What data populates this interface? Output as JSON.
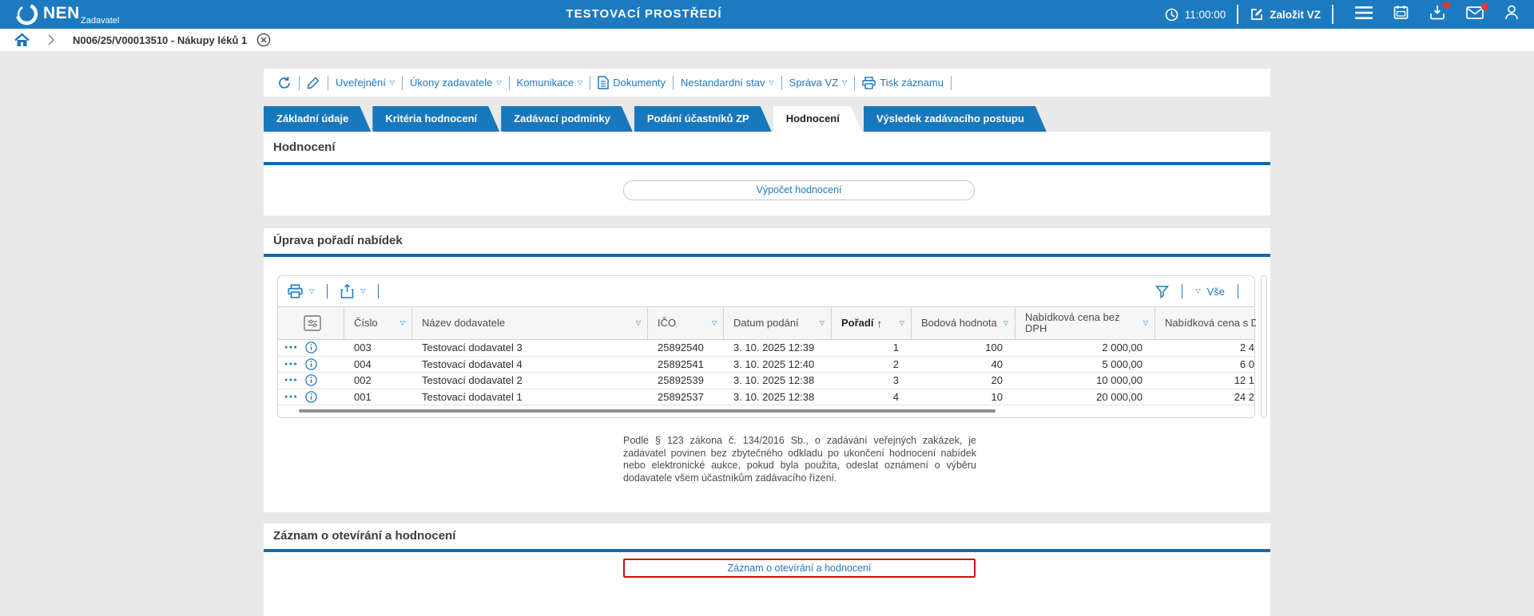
{
  "header": {
    "logo": "NEN",
    "logo_subtitle": "Zadavatel",
    "environment_title": "TESTOVACÍ PROSTŘEDÍ",
    "clock_time": "11:00:00",
    "create_button": "Založit VZ"
  },
  "breadcrumb": {
    "item": "N006/25/V00013510 - Nákupy léků 1"
  },
  "toolbar": {
    "items": [
      "Uveřejnění",
      "Úkony zadavatele",
      "Komunikace",
      "Dokumenty",
      "Nestandardní stav",
      "Správa VZ",
      "Tisk záznamu"
    ]
  },
  "tabs": [
    "Základní údaje",
    "Kritéria hodnocení",
    "Zadávací podmínky",
    "Podání účastníků ZP",
    "Hodnocení",
    "Výsledek zadávacího postupu"
  ],
  "active_tab": "Hodnocení",
  "sections": {
    "hodnoceni": {
      "title": "Hodnocení",
      "compute_button": "Výpočet hodnocení"
    },
    "uprava": {
      "title": "Úprava pořadí nabídek",
      "note": "Podle § 123 zákona č. 134/2016 Sb., o zadávání veřejných zakázek, je zadavatel povinen bez zbytečného odkladu po ukončení hodnocení nabídek nebo elektronické aukce, pokud byla použita, odeslat oznámení o výběru dodavatele všem účastníkům zadávacího řízení."
    },
    "zaznam": {
      "title": "Záznam o otevírání a hodnocení",
      "record_button": "Záznam o otevírání a hodnocení"
    }
  },
  "table": {
    "filter_all_label": "Vše",
    "columns": [
      "Číslo",
      "Název dodavatele",
      "IČO",
      "Datum podání",
      "Pořadí",
      "Bodová hodnota",
      "Nabídková cena bez DPH",
      "Nabídková cena s DPH"
    ],
    "sorted_column": "Pořadí",
    "rows": [
      {
        "cislo": "003",
        "nazev": "Testovací dodavatel 3",
        "ico": "25892540",
        "datum": "3. 10. 2025 12:39",
        "poradi": "1",
        "body": "100",
        "cena_bez_dph": "2 000,00",
        "cena_s_dph": "2 4"
      },
      {
        "cislo": "004",
        "nazev": "Testovací dodavatel 4",
        "ico": "25892541",
        "datum": "3. 10. 2025 12:40",
        "poradi": "2",
        "body": "40",
        "cena_bez_dph": "5 000,00",
        "cena_s_dph": "6 0"
      },
      {
        "cislo": "002",
        "nazev": "Testovací dodavatel 2",
        "ico": "25892539",
        "datum": "3. 10. 2025 12:38",
        "poradi": "3",
        "body": "20",
        "cena_bez_dph": "10 000,00",
        "cena_s_dph": "12 1"
      },
      {
        "cislo": "001",
        "nazev": "Testovací dodavatel 1",
        "ico": "25892537",
        "datum": "3. 10. 2025 12:38",
        "poradi": "4",
        "body": "10",
        "cena_bez_dph": "20 000,00",
        "cena_s_dph": "24 2"
      }
    ]
  },
  "colors": {
    "header_blue": "#1c7ac1",
    "tab_blue": "#1878be",
    "accent_blue": "#1f78bf",
    "underline_blue": "#1668a9",
    "alert_red": "#cb1010",
    "notification_red": "#e03a2f",
    "page_background": "#e9e9e9"
  }
}
